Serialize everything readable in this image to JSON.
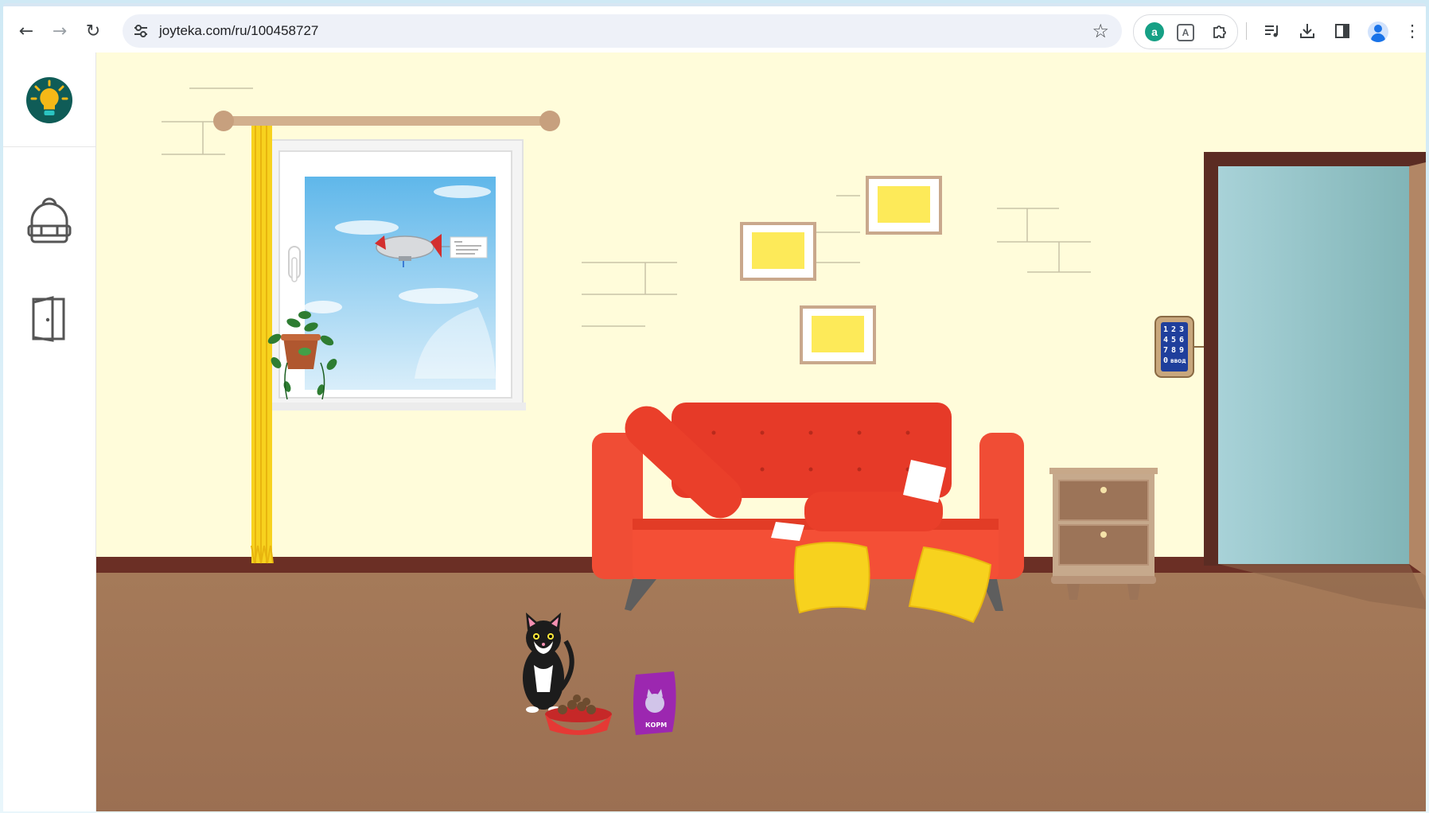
{
  "browser": {
    "url": "joyteka.com/ru/100458727",
    "icons": {
      "back": "arrow-left-icon",
      "forward": "arrow-right-icon",
      "reload": "reload-icon",
      "site_info": "tune-icon",
      "bookmark": "star-icon",
      "extension_1": "a-extension-icon",
      "extension_2": "bag-extension-icon",
      "extensions": "puzzle-icon",
      "media": "playlist-icon",
      "downloads": "download-icon",
      "side_panel": "side-panel-icon",
      "profile": "profile-icon",
      "menu": "kebab-menu-icon"
    },
    "extension_a_letter": "a",
    "extension_bag_letter": "A"
  },
  "sidebar": {
    "logo": "lightbulb-logo-icon",
    "items": [
      {
        "icon": "backpack-icon"
      },
      {
        "icon": "door-exit-icon"
      }
    ]
  },
  "scene": {
    "keypad": {
      "digits": [
        "1",
        "2",
        "3",
        "4",
        "5",
        "6",
        "7",
        "8",
        "9",
        "0"
      ],
      "enter_label": "ВВОД"
    },
    "food_bag_label": "КОРМ",
    "colors": {
      "wall": "#fffbd9",
      "floor": "#a87b5a",
      "baseboard": "#6b2f25",
      "sofa": "#ef4a30",
      "curtain": "#f7d21e",
      "pillows": "#f7d21e",
      "door_frame": "#5b2c23",
      "door_glass": "#8fc1c6"
    }
  }
}
